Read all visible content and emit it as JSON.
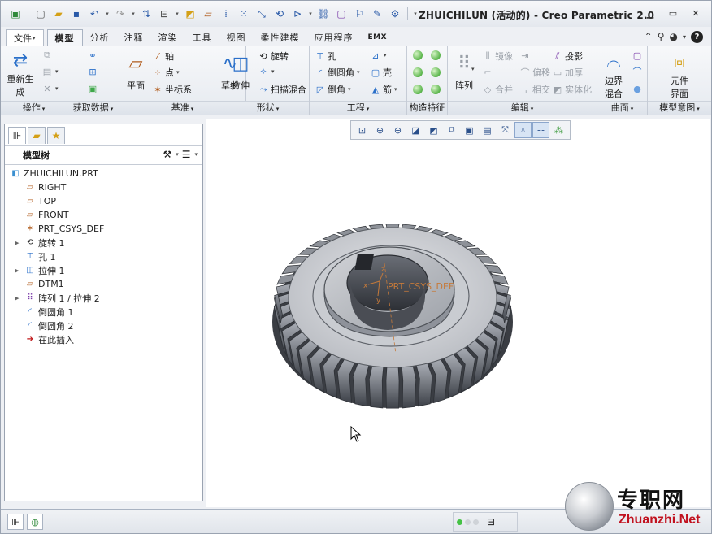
{
  "window": {
    "title": "ZHUICHILUN (活动的) - Creo Parametric 2.0"
  },
  "quick_access": [
    "new-icon",
    "open-icon",
    "save-icon",
    "undo-icon",
    "redo-icon",
    "regenerate-icon",
    "windows-icon",
    "close-icon"
  ],
  "tabs": [
    {
      "label": "文件",
      "kind": "file"
    },
    {
      "label": "模型",
      "kind": "active"
    },
    {
      "label": "分析"
    },
    {
      "label": "注释"
    },
    {
      "label": "渲染"
    },
    {
      "label": "工具"
    },
    {
      "label": "视图"
    },
    {
      "label": "柔性建模"
    },
    {
      "label": "应用程序"
    },
    {
      "label": "EMX"
    }
  ],
  "ribbon": {
    "groups": {
      "operations": "操作",
      "get_data": "获取数据",
      "datum": "基准",
      "shapes": "形状",
      "engineering": "工程",
      "construction": "构造特征",
      "editing": "编辑",
      "surfaces": "曲面",
      "model_intent": "模型意图"
    },
    "buttons": {
      "regenerate_line1": "重新生",
      "regenerate_line2": "成",
      "plane": "平面",
      "axis": "轴",
      "point": "点",
      "csys": "坐标系",
      "sketch": "草绘",
      "extrude": "拉伸",
      "revolve": "旋转",
      "sweep_blend": "扫描混合",
      "hole": "孔",
      "round": "倒圆角",
      "chamfer": "倒角",
      "shell": "壳",
      "rib": "筋",
      "pattern": "阵列",
      "mirror": "镜像",
      "trim": "修剪",
      "merge": "合并",
      "offset": "偏移",
      "intersect": "相交",
      "project": "投影",
      "thicken": "加厚",
      "solidify": "实体化",
      "boundary_line1": "边界",
      "boundary_line2": "混合",
      "component_line1": "元件",
      "component_line2": "界面"
    }
  },
  "model_tree": {
    "header": "模型树",
    "items": [
      {
        "label": "ZHUICHILUN.PRT",
        "icon": "part-icon",
        "expandable": false
      },
      {
        "label": "RIGHT",
        "icon": "datum-plane-icon",
        "expandable": false
      },
      {
        "label": "TOP",
        "icon": "datum-plane-icon",
        "expandable": false
      },
      {
        "label": "FRONT",
        "icon": "datum-plane-icon",
        "expandable": false
      },
      {
        "label": "PRT_CSYS_DEF",
        "icon": "csys-icon",
        "expandable": false
      },
      {
        "label": "旋转 1",
        "icon": "revolve-icon",
        "expandable": true
      },
      {
        "label": "孔 1",
        "icon": "hole-icon",
        "expandable": false
      },
      {
        "label": "拉伸 1",
        "icon": "extrude-icon",
        "expandable": true
      },
      {
        "label": "DTM1",
        "icon": "datum-plane-icon",
        "expandable": false
      },
      {
        "label": "阵列 1 / 拉伸 2",
        "icon": "pattern-icon",
        "expandable": true
      },
      {
        "label": "倒圆角 1",
        "icon": "round-icon",
        "expandable": false
      },
      {
        "label": "倒圆角 2",
        "icon": "round-icon",
        "expandable": false
      },
      {
        "label": "在此插入",
        "icon": "insert-here-icon",
        "expandable": false
      }
    ]
  },
  "graphics": {
    "csys_label": "PRT_CSYS_DEF",
    "axis_x": "x",
    "axis_y": "y",
    "axis_z": "z"
  },
  "watermark": {
    "line1": "专职网",
    "line2": "Zhuanzhi.Net"
  }
}
